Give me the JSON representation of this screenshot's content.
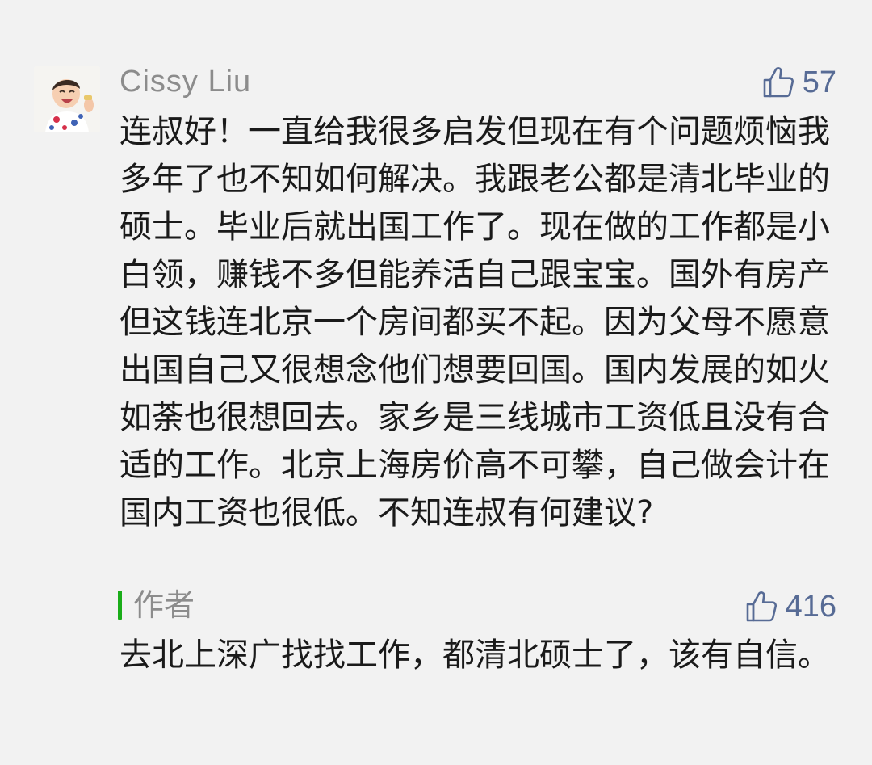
{
  "comment": {
    "nickname": "Cissy Liu",
    "likes": "57",
    "avatar_icon": "baby-photo-avatar",
    "text": "连叔好！一直给我很多启发但现在有个问题烦恼我多年了也不知如何解决。我跟老公都是清北毕业的硕士。毕业后就出国工作了。现在做的工作都是小白领，赚钱不多但能养活自己跟宝宝。国外有房产但这钱连北京一个房间都买不起。因为父母不愿意出国自己又很想念他们想要回国。国内发展的如火如荼也很想回去。家乡是三线城市工资低且没有合适的工作。北京上海房价高不可攀，自己做会计在国内工资也很低。不知连叔有何建议?"
  },
  "reply": {
    "author_label": "作者",
    "likes": "416",
    "text": "去北上深广找找工作，都清北硕士了，该有自信。"
  },
  "colors": {
    "background": "#f2f2f2",
    "nickname": "#8c8c8c",
    "like_blue": "#576b95",
    "author_bar": "#1aad19",
    "body_text": "#1a1a1a"
  },
  "icons": {
    "like": "thumbs-up-icon"
  }
}
